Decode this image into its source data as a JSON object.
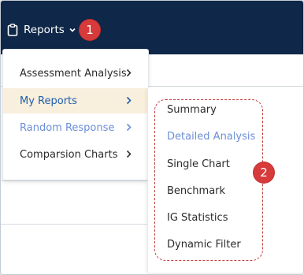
{
  "header": {
    "reports_label": "Reports",
    "background_color": "#0f2748",
    "reports_icon": "clipboard-icon",
    "dropdown_icon": "chevron-down-icon"
  },
  "badges": {
    "step1": "1",
    "step2": "2",
    "color": "#d63a3a"
  },
  "menu": {
    "items": [
      {
        "label": "Assessment Analysis"
      },
      {
        "label": "My Reports"
      },
      {
        "label": "Random Response"
      },
      {
        "label": "Comparsion Charts"
      }
    ],
    "active_bg": "#f9efdd",
    "active_text": "#1d5fae"
  },
  "submenu": {
    "items": [
      {
        "label": "Summary"
      },
      {
        "label": "Detailed Analysis"
      },
      {
        "label": "Single Chart"
      },
      {
        "label": "Benchmark"
      },
      {
        "label": "IG Statistics"
      },
      {
        "label": "Dynamic Filter"
      }
    ],
    "highlight_color": "#6c8fd6",
    "outline_color": "#c23d3d"
  }
}
